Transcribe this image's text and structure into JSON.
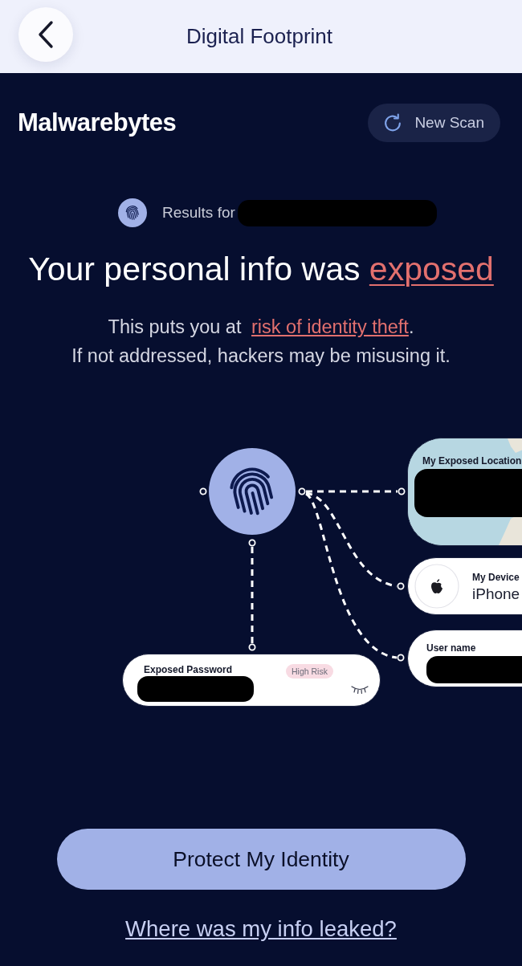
{
  "header": {
    "title": "Digital Footprint"
  },
  "brand": {
    "logo": "Malwarebytes",
    "action": "New Scan"
  },
  "results": {
    "label": "Results for"
  },
  "headline": {
    "text": "Your personal info was",
    "emphasis": "exposed"
  },
  "description": {
    "before": "This puts you at",
    "link": "risk of identity theft",
    "after": ".",
    "line_2": "If not addressed, hackers may be misusing it."
  },
  "diagram": {
    "nodes": [
      {
        "kind": "location",
        "label": "My Exposed Location"
      },
      {
        "kind": "device",
        "label": "My Device",
        "value": "iPhone"
      },
      {
        "kind": "username",
        "label": "User name"
      },
      {
        "kind": "password",
        "label": "Exposed Password",
        "badge": "High Risk"
      }
    ]
  },
  "primary_button": "Protect My Identity",
  "secondary_link": "Where was my info leaked?"
}
